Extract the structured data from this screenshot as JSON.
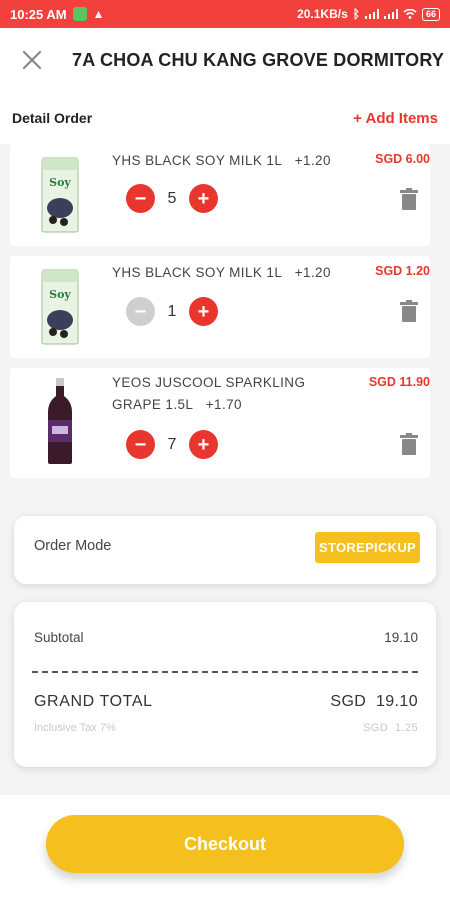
{
  "status_bar": {
    "time": "10:25 AM",
    "speed": "20.1KB/s",
    "battery": "66"
  },
  "header": {
    "title": "7A CHOA CHU KANG GROVE DORMITORY"
  },
  "detail": {
    "label": "Detail Order",
    "add_items": "+ Add Items"
  },
  "items": [
    {
      "name": "YHS BLACK SOY MILK 1L",
      "addon": "+1.20",
      "price": "SGD 6.00",
      "qty": "5"
    },
    {
      "name": "YHS BLACK SOY MILK 1L",
      "addon": "+1.20",
      "price": "SGD 1.20",
      "qty": "1"
    },
    {
      "name_line1": "YEOS JUSCOOL SPARKLING",
      "name_line2": "GRAPE 1.5L",
      "addon": "+1.70",
      "price": "SGD 11.90",
      "qty": "7"
    }
  ],
  "qty_controls": {
    "minus": "−",
    "plus": "+"
  },
  "order_mode": {
    "label": "Order Mode",
    "value": "STOREPICKUP"
  },
  "summary": {
    "subtotal_label": "Subtotal",
    "subtotal_value": "19.10",
    "grand_total_label": "GRAND TOTAL",
    "grand_total_value": "SGD  19.10",
    "tax_label": "Inclusive Tax 7%",
    "tax_value": "SGD  1.25"
  },
  "checkout": {
    "label": "Checkout"
  },
  "colors": {
    "status_bar": "#f2403c",
    "accent_red": "#e8362f",
    "accent_yellow": "#f5bf1d"
  },
  "icons": {
    "close": "close-icon",
    "trash": "trash-icon",
    "minus": "minus-icon",
    "plus": "plus-icon"
  }
}
